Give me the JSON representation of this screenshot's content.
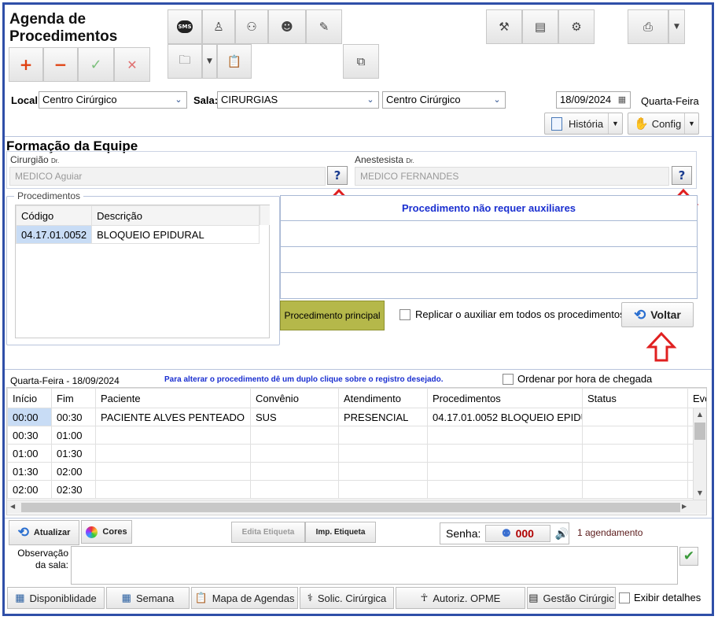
{
  "title": "Agenda de Procedimentos",
  "title_line1": "Agenda de",
  "title_line2": "Procedimentos",
  "toolbar": {
    "add": "+",
    "remove": "−",
    "confirm": "✓",
    "cancel": "✕",
    "sms": "SMS"
  },
  "filters": {
    "local_label": "Local",
    "local_value": "Centro Cirúrgico",
    "sala_label": "Sala:",
    "sala_value": "CIRURGIAS",
    "centro_value": "Centro Cirúrgico",
    "date_value": "18/09/2024",
    "weekday": "Quarta-Feira"
  },
  "buttons": {
    "historia": "História",
    "config": "Config"
  },
  "equipe": {
    "title": "Formação da Equipe",
    "cirurgiao_label": "Cirurgião",
    "cirurgiao_suffix": "Dr.",
    "cirurgiao_value": "MEDICO Aguiar",
    "anestesista_label": "Anestesista",
    "anestesista_suffix": "Dr.",
    "anestesista_value": "MEDICO FERNANDES",
    "help": "?"
  },
  "procedimentos": {
    "legend": "Procedimentos",
    "columns": [
      "Código",
      "Descrição"
    ],
    "rows": [
      {
        "codigo": "04.17.01.0052",
        "descricao": "BLOQUEIO EPIDURAL"
      }
    ]
  },
  "auxiliares": {
    "message": "Procedimento não requer auxiliares"
  },
  "principal_button": "Procedimento principal",
  "replicar_label": "Replicar o auxiliar em todos os procedimentos",
  "voltar": "Voltar",
  "agenda": {
    "date_header": "Quarta-Feira - 18/09/2024",
    "hint": "Para alterar o procedimento dê um duplo clique sobre o registro desejado.",
    "ordenar_label": "Ordenar por hora de chegada",
    "columns": [
      "Início",
      "Fim",
      "Paciente",
      "Convênio",
      "Atendimento",
      "Procedimentos",
      "Status",
      "Eve"
    ],
    "rows": [
      {
        "inicio": "00:00",
        "fim": "00:30",
        "paciente": "PACIENTE ALVES PENTEADO",
        "convenio": "SUS",
        "atendimento": "PRESENCIAL",
        "procedimentos": "04.17.01.0052 BLOQUEIO EPIDURAL",
        "status": ""
      },
      {
        "inicio": "00:30",
        "fim": "01:00",
        "paciente": "",
        "convenio": "",
        "atendimento": "",
        "procedimentos": "",
        "status": ""
      },
      {
        "inicio": "01:00",
        "fim": "01:30",
        "paciente": "",
        "convenio": "",
        "atendimento": "",
        "procedimentos": "",
        "status": ""
      },
      {
        "inicio": "01:30",
        "fim": "02:00",
        "paciente": "",
        "convenio": "",
        "atendimento": "",
        "procedimentos": "",
        "status": ""
      },
      {
        "inicio": "02:00",
        "fim": "02:30",
        "paciente": "",
        "convenio": "",
        "atendimento": "",
        "procedimentos": "",
        "status": ""
      }
    ]
  },
  "bottom": {
    "atualizar": "Atualizar",
    "cores": "Cores",
    "edita_etiqueta": "Edita Etiqueta",
    "imp_etiqueta": "Imp. Etiqueta",
    "senha_label": "Senha:",
    "senha_value": "000",
    "agendamentos": "1 agendamento",
    "observacao_line1": "Observação",
    "observacao_line2": "da sala:"
  },
  "footer": {
    "disponibilidade": "Disponiblidade",
    "semana": "Semana",
    "mapa": "Mapa de Agendas",
    "solic": "Solic. Cirúrgica",
    "autoriz": "Autoriz. OPME",
    "gestao": "Gestão Cirúrgic",
    "exibir": "Exibir detalhes"
  },
  "colors": {
    "border": "#2f4fa8",
    "accent_red": "#e03020",
    "selected_cell": "#c8dcf5",
    "principal_bg": "#b5b84a",
    "message_blue": "#1a2fd0"
  }
}
